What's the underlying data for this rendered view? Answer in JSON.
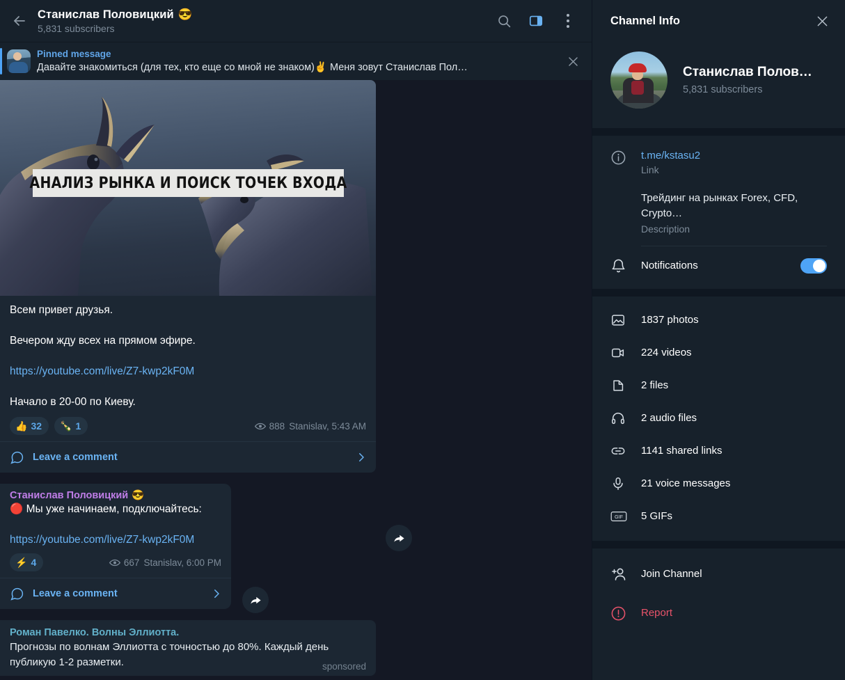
{
  "header": {
    "title": "Станислав Половицкий",
    "title_emoji": "😎",
    "subtitle": "5,831 subscribers",
    "search_icon": "search-icon",
    "sidebar_toggle_icon": "sidebar-toggle-icon",
    "menu_icon": "more-vertical-icon",
    "back_icon": "back-arrow-icon"
  },
  "pinned": {
    "label": "Pinned message",
    "text": "Давайте знакомиться  (для тех, кто еще со мной не знаком)✌ Меня зовут Станислав Пол…",
    "close_icon": "close-icon"
  },
  "messages": [
    {
      "photo_caption": "АНАЛИЗ РЫНКА И ПОИСК ТОЧЕК ВХОДА",
      "lines": [
        "Всем привет друзья.",
        "Вечером жду всех на прямом эфире."
      ],
      "link": "https://youtube.com/live/Z7-kwp2kF0M",
      "closing_line": "Начало в 20-00 по Киеву.",
      "reactions": [
        {
          "emoji": "👍",
          "count": "32"
        },
        {
          "emoji": "🍾",
          "count": "1"
        }
      ],
      "views": "888",
      "signature": "Stanislav, 5:43 AM",
      "comment_label": "Leave a comment"
    },
    {
      "author": "Станислав Половицкий",
      "author_emoji": "😎",
      "text": "🔴 Мы уже начинаем, подключайтесь:",
      "link": "https://youtube.com/live/Z7-kwp2kF0M",
      "reactions": [
        {
          "emoji": "⚡",
          "count": "4"
        }
      ],
      "views": "667",
      "signature": "Stanislav, 6:00 PM",
      "comment_label": "Leave a comment"
    }
  ],
  "sponsored": {
    "title": "Роман Павелко. Волны Эллиотта.",
    "text": "Прогнозы по волнам Эллиотта с точностью до 80%. Каждый день публикую 1-2 разметки.",
    "tag": "sponsored"
  },
  "sidebar": {
    "heading": "Channel Info",
    "close_icon": "close-icon",
    "profile_name": "Станислав Полов…",
    "profile_subtitle": "5,831 subscribers",
    "link": "t.me/kstasu2",
    "link_caption": "Link",
    "description": "Трейдинг на рынках Forex, CFD, Crypto…",
    "description_caption": "Description",
    "notifications_label": "Notifications",
    "notifications_on": true,
    "media": [
      {
        "icon": "photo-icon",
        "label": "1837 photos"
      },
      {
        "icon": "video-icon",
        "label": "224 videos"
      },
      {
        "icon": "file-icon",
        "label": "2 files"
      },
      {
        "icon": "headphones-icon",
        "label": "2 audio files"
      },
      {
        "icon": "link-icon",
        "label": "1141 shared links"
      },
      {
        "icon": "microphone-icon",
        "label": "21 voice messages"
      },
      {
        "icon": "gif-icon",
        "label": "5 GIFs"
      }
    ],
    "actions": [
      {
        "icon": "add-user-icon",
        "label": "Join Channel",
        "danger": false
      },
      {
        "icon": "report-icon",
        "label": "Report",
        "danger": true
      }
    ]
  },
  "colors": {
    "accent": "#4ea4f6",
    "link": "#6ab3f3",
    "danger": "#e8536a",
    "bubble": "#1c2733",
    "chat_bg": "#141824",
    "panel_bg": "#17212b"
  }
}
